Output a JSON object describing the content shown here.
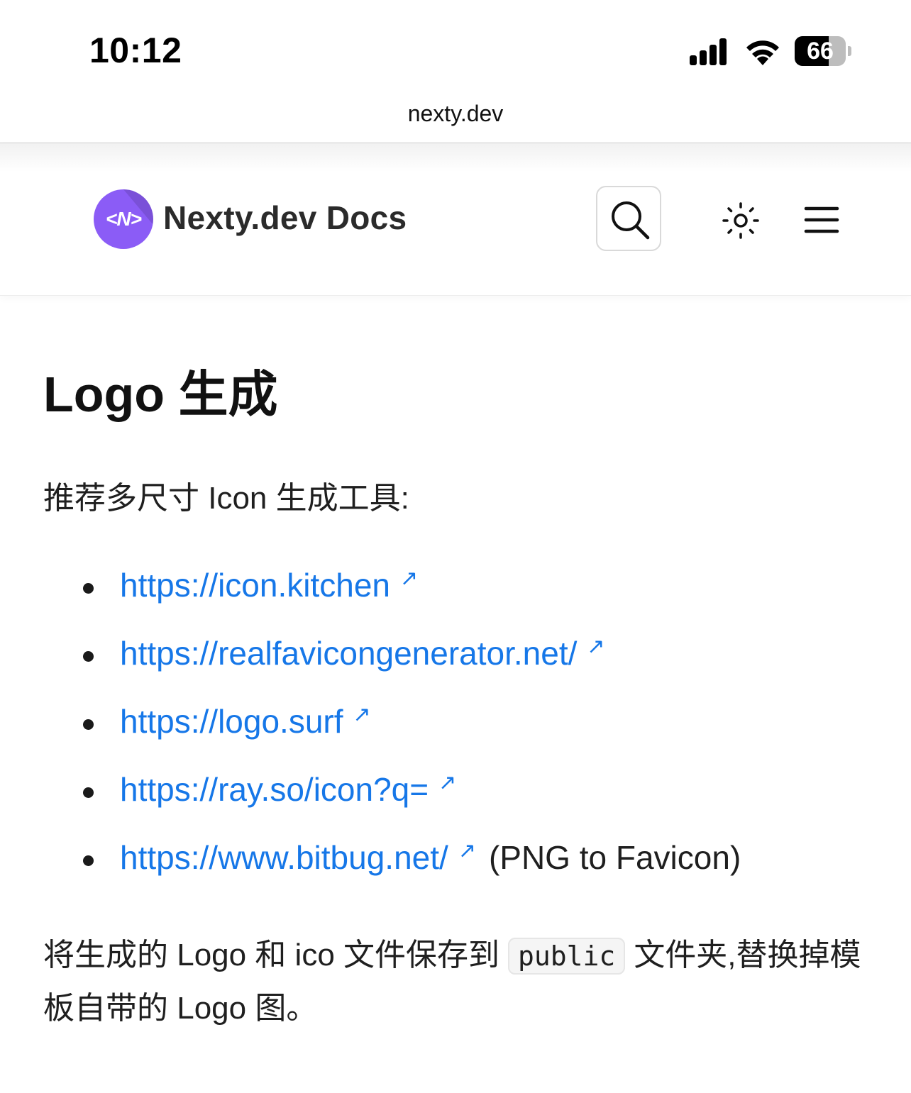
{
  "status_bar": {
    "time": "10:12",
    "battery": "66",
    "battery_level": 0.66
  },
  "browser": {
    "url": "nexty.dev"
  },
  "header": {
    "logo_text": "<N>",
    "site_title": "Nexty.dev Docs",
    "icons": {
      "search": "search-icon",
      "theme": "sun-icon",
      "menu": "hamburger-menu-icon"
    }
  },
  "content": {
    "title": "Logo 生成",
    "intro": "推荐多尺寸 Icon 生成工具:",
    "links": [
      {
        "url": "https://icon.kitchen",
        "note": ""
      },
      {
        "url": "https://realfavicongenerator.net/",
        "note": ""
      },
      {
        "url": "https://logo.surf",
        "note": ""
      },
      {
        "url": "https://ray.so/icon?q=",
        "note": ""
      },
      {
        "url": "https://www.bitbug.net/",
        "note": "(PNG to Favicon)"
      }
    ],
    "external_icon": "↗",
    "paragraph": {
      "before_code": "将生成的 Logo 和 ico 文件保存到",
      "code": "public",
      "after_code": "文件夹,替换掉模板自带的 Logo 图。"
    }
  },
  "colors": {
    "link": "#1677e8",
    "brand": "#8b5cf6"
  }
}
